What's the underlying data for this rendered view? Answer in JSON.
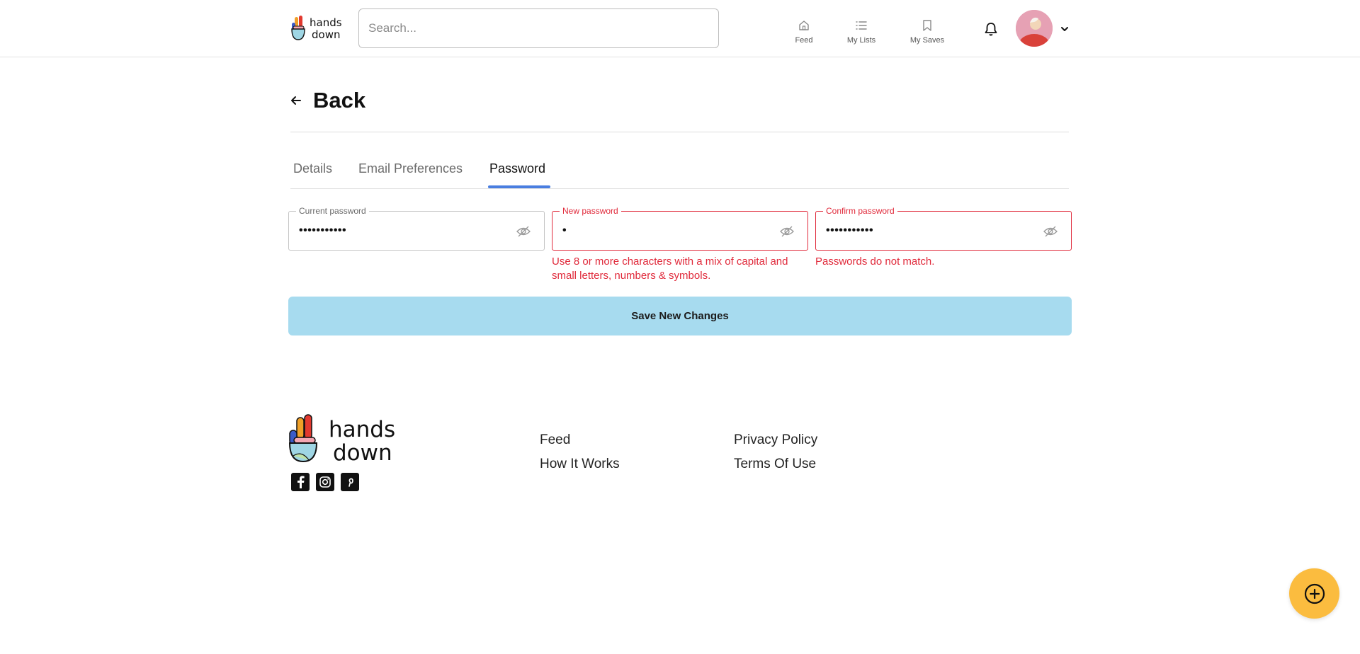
{
  "header": {
    "logo_text": [
      "hands",
      "down"
    ],
    "search_placeholder": "Search...",
    "nav": [
      {
        "label": "Feed",
        "icon": "home-icon"
      },
      {
        "label": "My Lists",
        "icon": "list-icon"
      },
      {
        "label": "My Saves",
        "icon": "bookmark-icon"
      }
    ],
    "notifications_icon": "bell-icon",
    "avatar_icon": "avatar",
    "menu_icon": "chevron-down-icon"
  },
  "back": {
    "label": "Back",
    "icon": "arrow-left-icon"
  },
  "tabs": [
    {
      "label": "Details",
      "active": false
    },
    {
      "label": "Email Preferences",
      "active": false
    },
    {
      "label": "Password",
      "active": true
    }
  ],
  "form": {
    "current_password": {
      "label": "Current password",
      "value": "•••••••••••",
      "error": null
    },
    "new_password": {
      "label": "New password",
      "value": "•",
      "error": "Use 8 or more characters with a mix of capital and small letters, numbers & symbols."
    },
    "confirm_password": {
      "label": "Confirm password",
      "value": "•••••••••••",
      "error": "Passwords do not match."
    },
    "toggle_icon": "eye-off-icon",
    "save_label": "Save New Changes"
  },
  "footer": {
    "logo_text": [
      "hands",
      "down"
    ],
    "social": [
      "facebook-icon",
      "instagram-icon",
      "pinterest-icon"
    ],
    "links_col1": [
      "Feed",
      "How It Works"
    ],
    "links_col2": [
      "Privacy Policy",
      "Terms Of Use"
    ]
  },
  "fab_icon": "plus-circle-icon",
  "colors": {
    "accent": "#4a7ee0",
    "error": "#e0293a",
    "save_button": "#a7dbef",
    "fab": "#fbbc3f"
  }
}
